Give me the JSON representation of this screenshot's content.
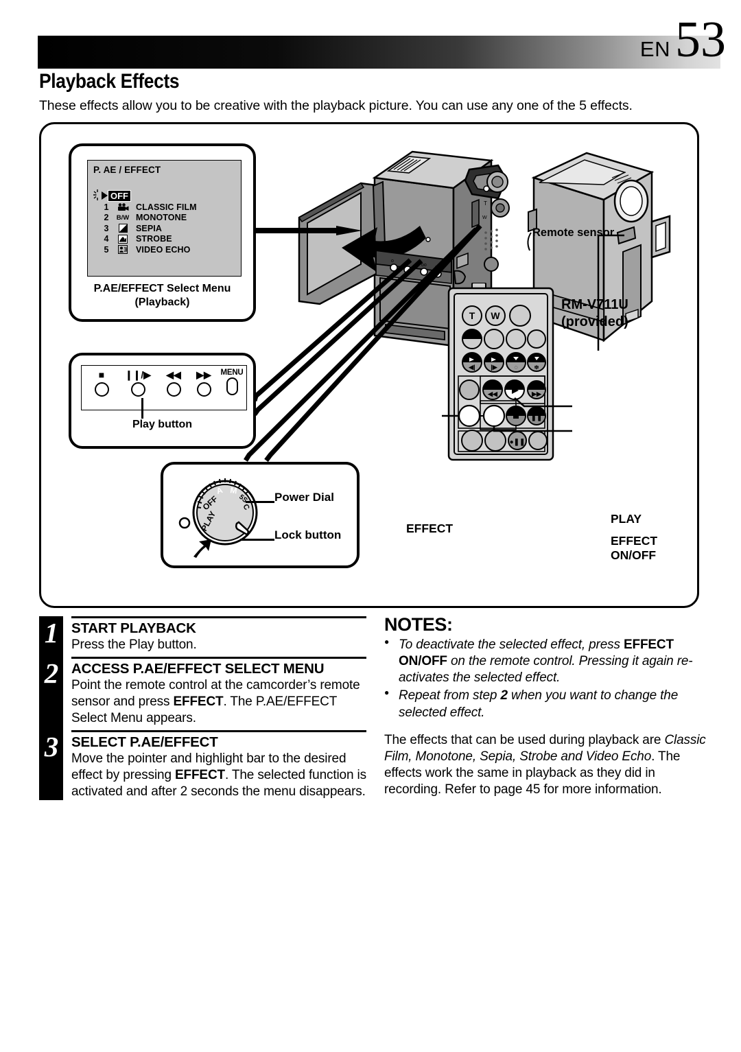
{
  "header": {
    "lang_code": "EN",
    "page_number": "53"
  },
  "title": "Playback Effects",
  "intro": "These effects allow you to be creative with the playback picture. You can use any one of the 5 effects.",
  "menu_screen": {
    "title": "P. AE / EFFECT",
    "off_label": "OFF",
    "items": [
      {
        "num": "1",
        "icon": "classic-film-icon",
        "label": "CLASSIC FILM"
      },
      {
        "num": "2",
        "icon": "bw-icon",
        "label": "MONOTONE"
      },
      {
        "num": "3",
        "icon": "sepia-icon",
        "label": "SEPIA"
      },
      {
        "num": "4",
        "icon": "strobe-icon",
        "label": "STROBE"
      },
      {
        "num": "5",
        "icon": "video-echo-icon",
        "label": "VIDEO ECHO"
      }
    ],
    "caption_line1": "P.AE/EFFECT Select Menu",
    "caption_line2": "(Playback)"
  },
  "button_panel": {
    "buttons": [
      {
        "glyph": "■",
        "name": "stop-button"
      },
      {
        "glyph": "❙❙/▶",
        "name": "play-pause-button"
      },
      {
        "glyph": "◀◀",
        "name": "rewind-button"
      },
      {
        "glyph": "▶▶",
        "name": "fast-forward-button"
      }
    ],
    "menu_label": "MENU",
    "caption": "Play button"
  },
  "dial": {
    "positions": [
      "PLAY",
      "OFF",
      "A",
      "M",
      "5S",
      "C"
    ],
    "power_label": "Power Dial",
    "lock_label": "Lock button"
  },
  "camcorder": {
    "remote_sensor_label": "Remote sensor"
  },
  "remote": {
    "model_line1": "RM-V711U",
    "model_line2": "(provided)",
    "zoom_t": "T",
    "zoom_w": "W",
    "label_effect": "EFFECT",
    "label_play": "PLAY",
    "label_effect_onoff_line1": "EFFECT",
    "label_effect_onoff_line2": "ON/OFF"
  },
  "steps": [
    {
      "num": "1",
      "heading": "START PLAYBACK",
      "body": "Press the Play button."
    },
    {
      "num": "2",
      "heading": "ACCESS P.AE/EFFECT SELECT MENU",
      "body_pre": "Point the remote control at the camcorder’s remote sensor and press ",
      "body_bold": "EFFECT",
      "body_post": ". The P.AE/EFFECT Select Menu appears."
    },
    {
      "num": "3",
      "heading": "SELECT P.AE/EFFECT",
      "body_pre": "Move the pointer and highlight bar to the desired effect by pressing ",
      "body_bold": "EFFECT",
      "body_post": ". The selected function is activated and after 2 seconds the menu disappears."
    }
  ],
  "notes": {
    "title": "NOTES:",
    "items": [
      {
        "pre": "To deactivate the selected effect, press ",
        "bold": "EFFECT ON/OFF",
        "post": " on the remote control. Pressing it again re-activates the selected effect."
      },
      {
        "pre": "Repeat from step ",
        "bold": "2",
        "post": " when you want to change the selected effect."
      }
    ],
    "paragraph_pre": "The effects that can be used during playback are ",
    "paragraph_italic": "Classic Film, Monotone, Sepia, Strobe and Video Echo",
    "paragraph_post": ". The effects work the same in playback as they did in recording. Refer to page 45 for more information."
  }
}
